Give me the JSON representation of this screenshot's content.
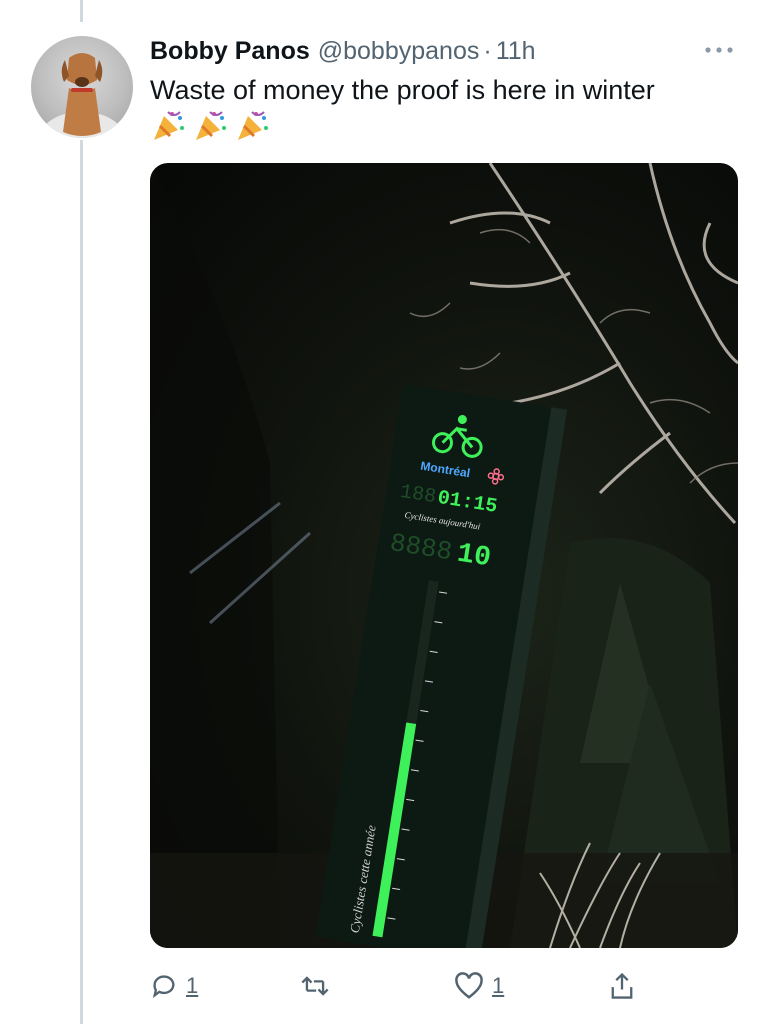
{
  "tweet": {
    "display_name": "Bobby Panos",
    "handle": "@bobbypanos",
    "separator": "·",
    "time": "11h",
    "text": "Waste of money the proof is here in winter",
    "emojis": [
      "party-popper",
      "party-popper",
      "party-popper"
    ]
  },
  "photo": {
    "city_label": "Montréal",
    "time_display": "01:15",
    "today_caption": "Cyclistes aujourd'hui",
    "today_count": "10",
    "year_caption": "Cyclistes cette année",
    "bar_level": 0.6,
    "colors": {
      "led_green": "#3ef05a",
      "sky": "#0c0f0b"
    }
  },
  "actions": {
    "reply_count": "1",
    "retweet_count": "",
    "like_count": "1",
    "icons": [
      "reply-icon",
      "retweet-icon",
      "like-icon",
      "share-icon"
    ]
  }
}
